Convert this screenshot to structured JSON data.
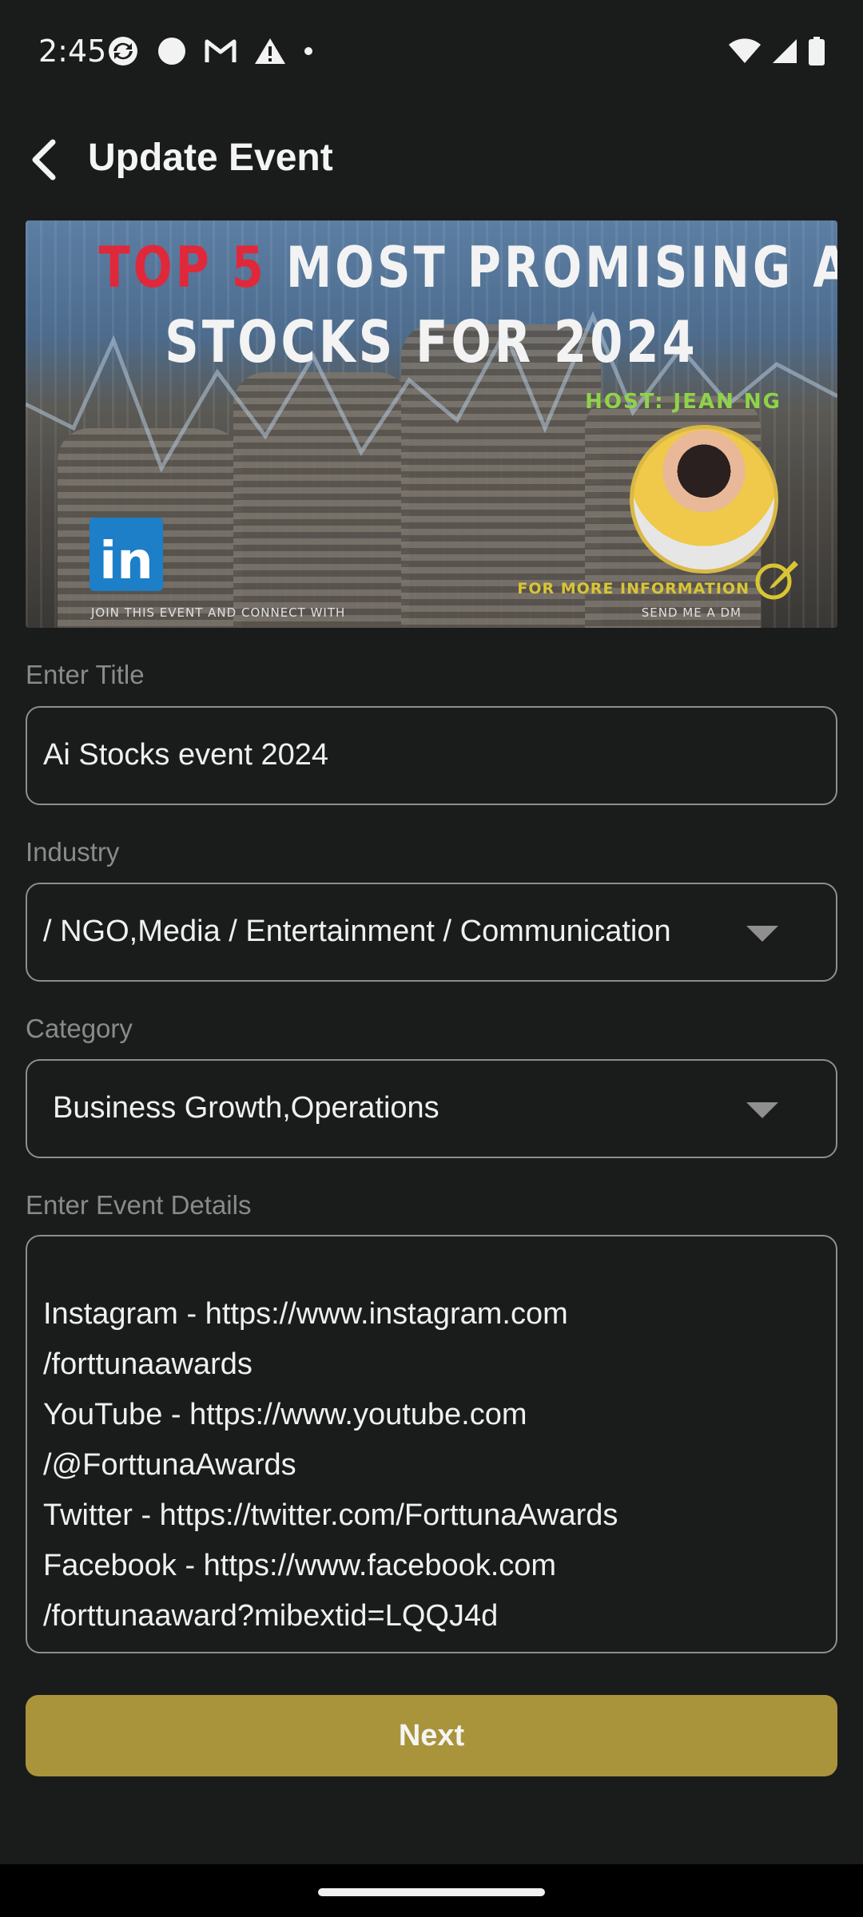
{
  "status_bar": {
    "time": "2:45",
    "left_icons": [
      "sync-icon",
      "circle-icon",
      "gmail-icon",
      "warning-icon",
      "dot-icon"
    ],
    "right_icons": [
      "wifi-icon",
      "signal-icon",
      "battery-icon"
    ]
  },
  "header": {
    "title": "Update Event",
    "back_icon": "chevron-left-icon"
  },
  "banner": {
    "line1_highlight": "TOP 5",
    "line1_rest": "MOST PROMISING AI",
    "line2": "STOCKS FOR 2024",
    "host": "HOST: JEAN NG",
    "linkedin_glyph": "in",
    "join_text": "JOIN THIS EVENT AND CONNECT WITH",
    "more_info": "FOR MORE INFORMATION",
    "send_dm": "SEND ME A DM"
  },
  "form": {
    "title_label": "Enter Title",
    "title_value": "Ai Stocks event 2024",
    "industry_label": "Industry",
    "industry_value": " / NGO,Media / Entertainment / Communication",
    "category_label": "Category",
    "category_value": "Business Growth,Operations",
    "details_label": "Enter Event Details",
    "details_value": "Instagram - https://www.instagram.com\n/forttunaawards\nYouTube - https://www.youtube.com\n/@ForttunaAwards\nTwitter - https://twitter.com/ForttunaAwards\nFacebook - https://www.facebook.com\n/forttunaaward?mibextid=LQQJ4d"
  },
  "actions": {
    "next_label": "Next"
  },
  "colors": {
    "background": "#1a1b1b",
    "accent": "#a9943c",
    "border": "#8e8e8e",
    "label": "#8a8a8a"
  }
}
